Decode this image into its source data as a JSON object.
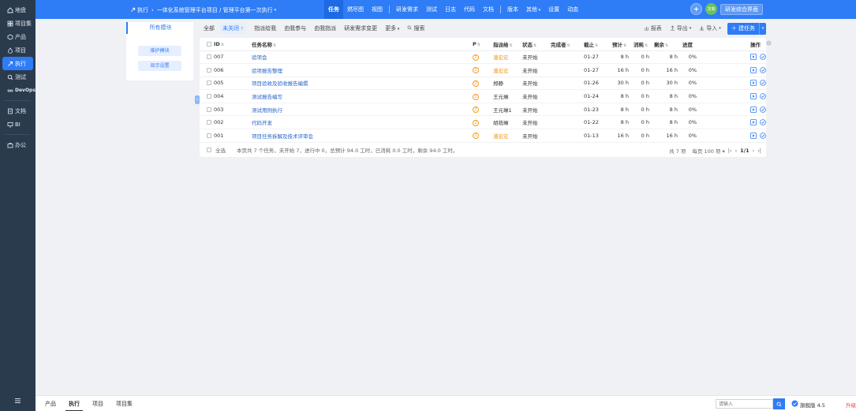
{
  "sidebar": {
    "items": [
      {
        "label": "地盘",
        "icon": "home-icon"
      },
      {
        "label": "项目集",
        "icon": "grid-icon"
      },
      {
        "label": "产品",
        "icon": "cube-icon"
      },
      {
        "label": "项目",
        "icon": "drop-icon"
      },
      {
        "label": "执行",
        "icon": "rocket-icon",
        "active": true
      },
      {
        "label": "测试",
        "icon": "search-icon"
      },
      {
        "label": "DevOps",
        "icon": "infinity-icon"
      },
      {
        "label": "文档",
        "icon": "doc-icon"
      },
      {
        "label": "BI",
        "icon": "monitor-icon"
      },
      {
        "label": "办公",
        "icon": "briefcase-icon"
      }
    ]
  },
  "header": {
    "crumb_root": "执行",
    "crumb_path": "一体化系统管理平台项目 / 管理平台第一次执行",
    "nav": [
      "任务",
      "燃尽图",
      "视图",
      "研发需求",
      "测试",
      "日志",
      "代码",
      "文档",
      "版本",
      "其他",
      "设置",
      "动态"
    ],
    "avatar": "龙菲",
    "switch_label": "研发综合界面"
  },
  "module_panel": {
    "title": "所有模块",
    "maintain_label": "维护模块",
    "display_label": "显示设置"
  },
  "filters": {
    "all": "全部",
    "unclosed": "未关闭",
    "unclosed_count": "7",
    "assigned_to_me": "指派给我",
    "involved": "由我参与",
    "created_by_me": "由我指派",
    "story_change": "研发需求变更",
    "more": "更多",
    "search": "搜索",
    "report": "报表",
    "export": "导出",
    "import": "导入",
    "new_task": "建任务"
  },
  "table": {
    "columns": [
      "ID",
      "任务名称",
      "P",
      "指派给",
      "状态",
      "完成者",
      "截止",
      "预计",
      "消耗",
      "剩余",
      "进度",
      "操作"
    ],
    "rows": [
      {
        "id": "007",
        "name": "验项会",
        "pri": "2",
        "assignee": "潘宏宏",
        "orange": true,
        "status": "未开始",
        "finisher": "",
        "deadline": "01-27",
        "est": "8 h",
        "consumed": "0 h",
        "left": "8 h",
        "progress": "0%"
      },
      {
        "id": "006",
        "name": "验项报告整理",
        "pri": "2",
        "assignee": "潘宏宏",
        "orange": true,
        "status": "未开始",
        "finisher": "",
        "deadline": "01-27",
        "est": "16 h",
        "consumed": "0 h",
        "left": "16 h",
        "progress": "0%"
      },
      {
        "id": "005",
        "name": "项目验收及验收报告编撰",
        "pri": "2",
        "assignee": "郑静",
        "orange": false,
        "status": "未开始",
        "finisher": "",
        "deadline": "01-26",
        "est": "30 h",
        "consumed": "0 h",
        "left": "30 h",
        "progress": "0%"
      },
      {
        "id": "004",
        "name": "测试报告编写",
        "pri": "2",
        "assignee": "王元琳",
        "orange": false,
        "status": "未开始",
        "finisher": "",
        "deadline": "01-24",
        "est": "8 h",
        "consumed": "0 h",
        "left": "8 h",
        "progress": "0%"
      },
      {
        "id": "003",
        "name": "测试用例执行",
        "pri": "2",
        "assignee": "王元琳1",
        "orange": false,
        "status": "未开始",
        "finisher": "",
        "deadline": "01-23",
        "est": "8 h",
        "consumed": "0 h",
        "left": "8 h",
        "progress": "0%"
      },
      {
        "id": "002",
        "name": "代码开发",
        "pri": "2",
        "assignee": "胡萌琳",
        "orange": false,
        "status": "未开始",
        "finisher": "",
        "deadline": "01-22",
        "est": "8 h",
        "consumed": "0 h",
        "left": "8 h",
        "progress": "0%"
      },
      {
        "id": "001",
        "name": "项目任务拆解及技术评审会",
        "pri": "2",
        "assignee": "潘宏宏",
        "orange": true,
        "status": "未开始",
        "finisher": "",
        "deadline": "01-13",
        "est": "16 h",
        "consumed": "0 h",
        "left": "16 h",
        "progress": "0%"
      }
    ],
    "select_all": "全选",
    "summary": "本页共 7 个任务，未开始 7，进行中 0，总预计 94.0 工时，已消耗 0.0 工时，剩余 94.0 工时。",
    "pager_total": "共 7 项",
    "pager_per_page": "每页 100 项",
    "pager_page": "1/1"
  },
  "bottom": {
    "tabs": [
      "产品",
      "执行",
      "项目",
      "项目集"
    ],
    "active_tab": 1,
    "search_placeholder": "请输入",
    "version": "旗舰版 4.5",
    "upgrade": "升级"
  },
  "colors": {
    "primary": "#2e7cf6",
    "sidebar": "#2b3b4e",
    "priority": "#f59a23",
    "upgrade": "#e5483c"
  }
}
